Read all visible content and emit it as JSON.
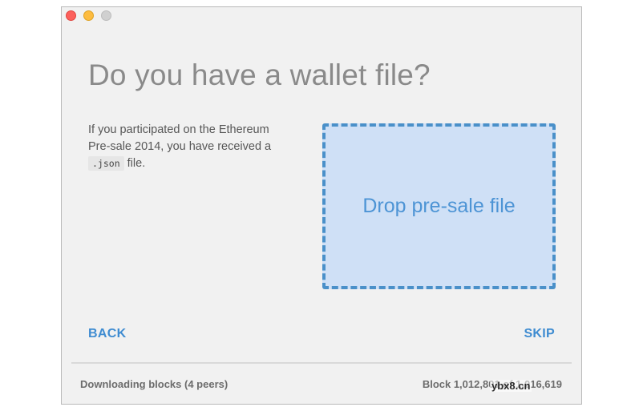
{
  "window": {
    "buttons": [
      "close",
      "minimize",
      "maximize"
    ]
  },
  "title": "Do you have a wallet file?",
  "description": {
    "text_before": "If you participated on the Ethereum Pre-sale 2014, you have received a",
    "code": ".json",
    "text_after": "file."
  },
  "dropzone": {
    "label": "Drop pre-sale file"
  },
  "nav": {
    "back_label": "BACK",
    "skip_label": "SKIP"
  },
  "status": {
    "downloading": "Downloading blocks (4 peers)",
    "block": "Block 1,012,801 of 1,016,619"
  },
  "watermark": "ybx8.cn",
  "colors": {
    "accent": "#3f8cd1",
    "dropzone_bg": "#cfe0f6",
    "dropzone_border": "#4a90c9"
  }
}
